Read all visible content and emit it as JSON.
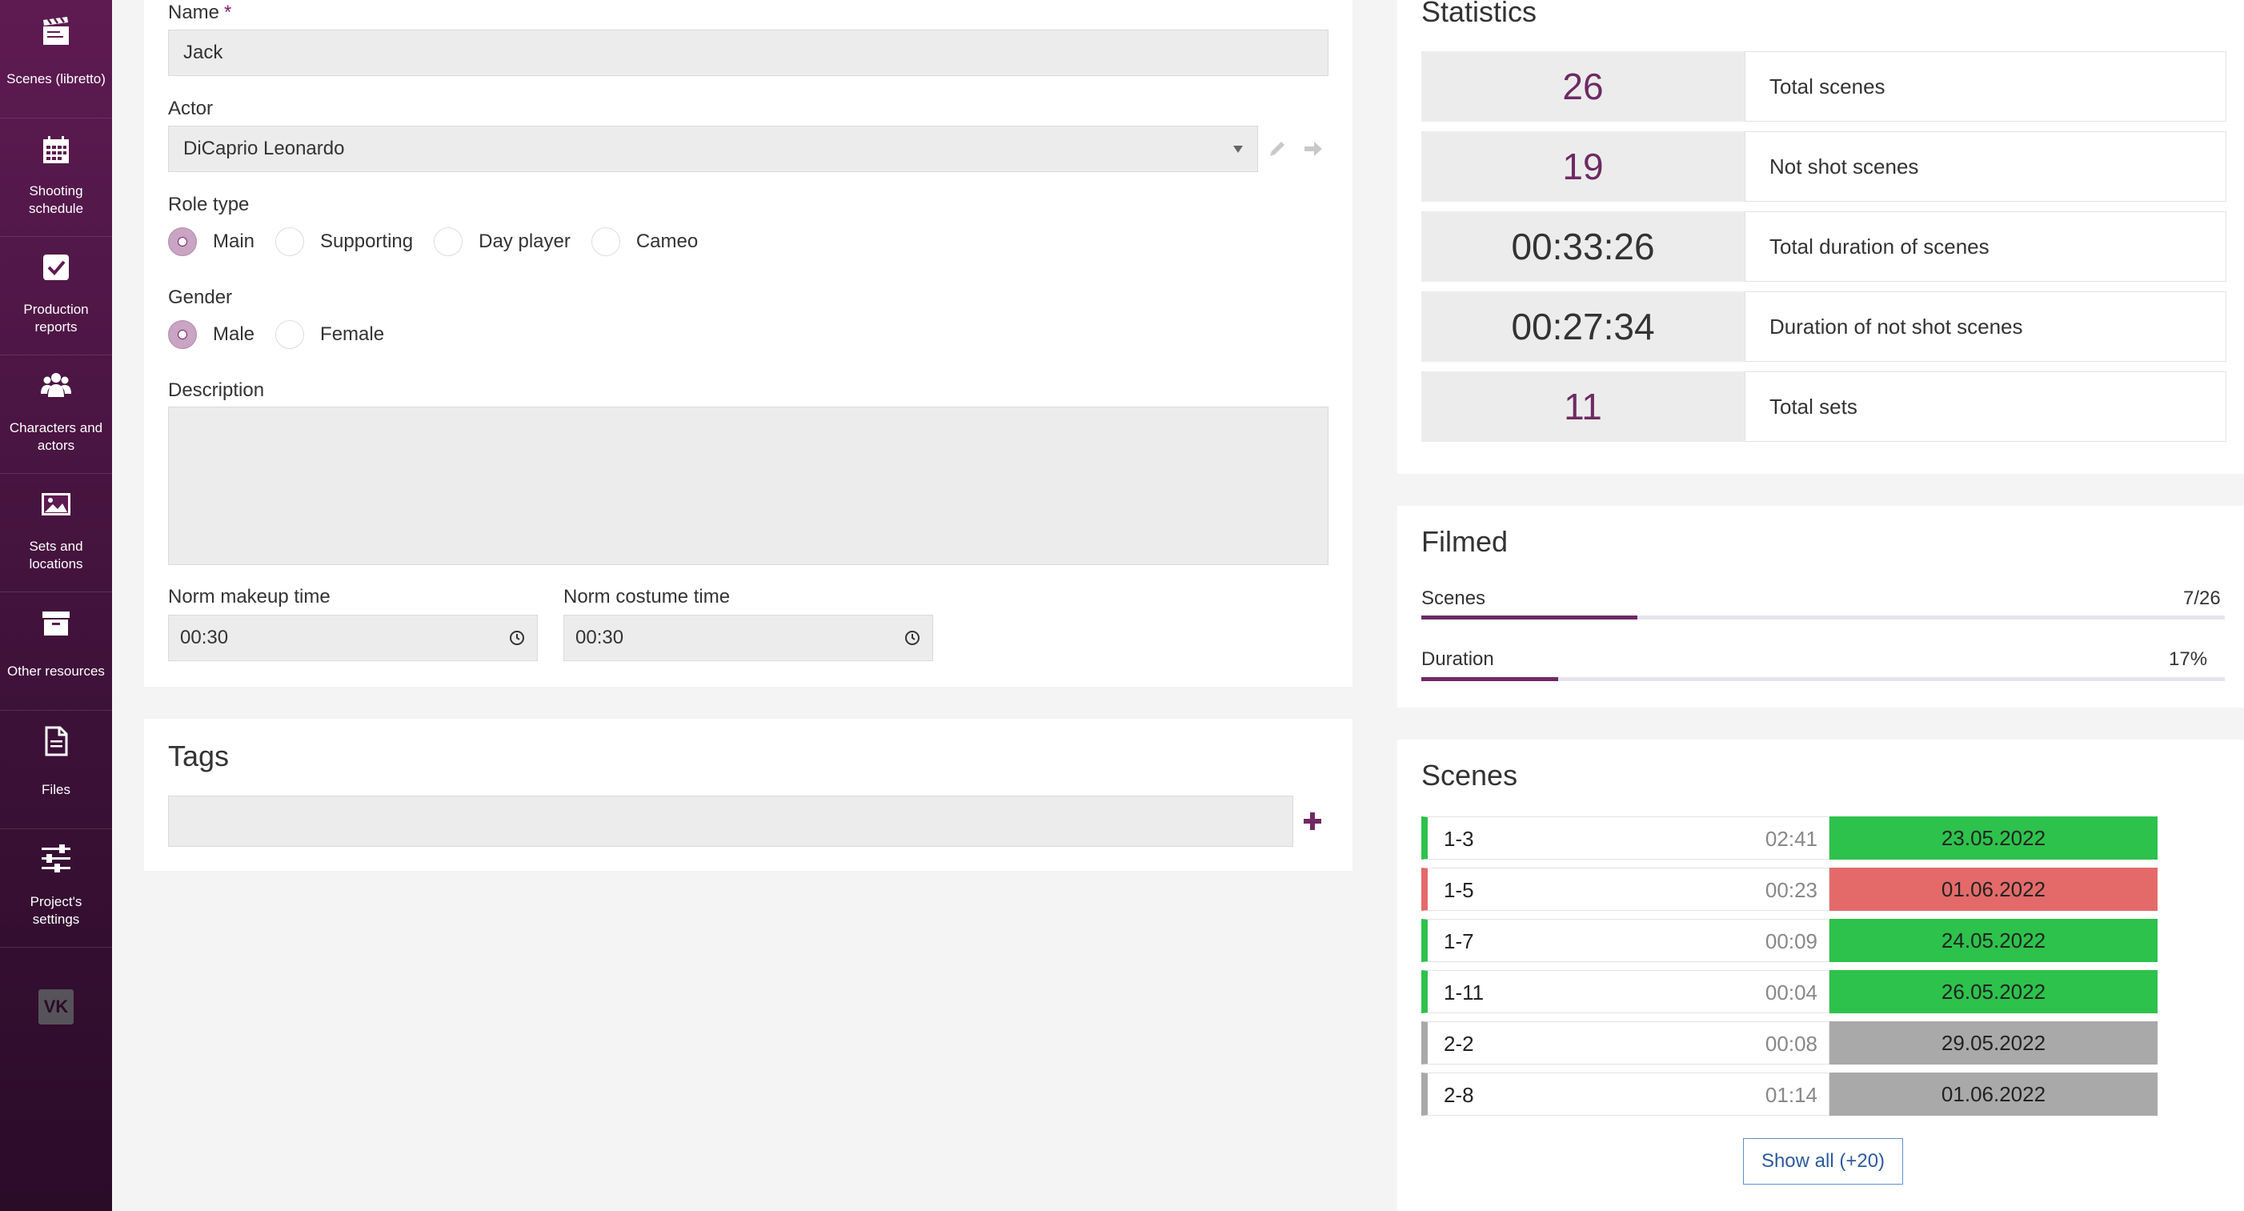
{
  "sidebar": {
    "items": [
      {
        "label": "Scenes (libretto)",
        "icon": "clapperboard-icon"
      },
      {
        "label": "Shooting\nschedule",
        "icon": "calendar-icon"
      },
      {
        "label": "Production\nreports",
        "icon": "checkbox-icon"
      },
      {
        "label": "Characters and\nactors",
        "icon": "people-icon"
      },
      {
        "label": "Sets and\nlocations",
        "icon": "image-icon"
      },
      {
        "label": "Other resources",
        "icon": "archive-icon"
      },
      {
        "label": "Files",
        "icon": "file-icon"
      },
      {
        "label": "Project's\nsettings",
        "icon": "sliders-icon"
      }
    ],
    "vk_icon": "vk-icon"
  },
  "form": {
    "name_label": "Name",
    "name_required": "*",
    "name_value": "Jack",
    "actor_label": "Actor",
    "actor_value": "DiCaprio Leonardo",
    "role_type_label": "Role type",
    "role_types": [
      "Main",
      "Supporting",
      "Day player",
      "Cameo"
    ],
    "role_type_selected": "Main",
    "gender_label": "Gender",
    "genders": [
      "Male",
      "Female"
    ],
    "gender_selected": "Male",
    "description_label": "Description",
    "description_value": "",
    "makeup_label": "Norm makeup time",
    "makeup_value": "00:30",
    "costume_label": "Norm costume time",
    "costume_value": "00:30"
  },
  "tags": {
    "title": "Tags",
    "add_icon": "plus-icon"
  },
  "statistics": {
    "title": "Statistics",
    "rows": [
      {
        "value": "26",
        "label": "Total scenes",
        "color": "#6e2a64"
      },
      {
        "value": "19",
        "label": "Not shot scenes",
        "color": "#6e2a64"
      },
      {
        "value": "00:33:26",
        "label": "Total duration of scenes",
        "color": "#333333"
      },
      {
        "value": "00:27:34",
        "label": "Duration of not shot scenes",
        "color": "#333333"
      },
      {
        "value": "11",
        "label": "Total sets",
        "color": "#6e2a64"
      }
    ]
  },
  "filmed": {
    "title": "Filmed",
    "scenes_label": "Scenes",
    "scenes_value": "7/26",
    "scenes_fraction": 0.269,
    "duration_label": "Duration",
    "duration_value": "17%",
    "duration_fraction": 0.17
  },
  "scenes": {
    "title": "Scenes",
    "rows": [
      {
        "id": "1-3",
        "duration": "02:41",
        "date": "23.05.2022",
        "status_color": "#2dc24c"
      },
      {
        "id": "1-5",
        "duration": "00:23",
        "date": "01.06.2022",
        "status_color": "#e46a6a"
      },
      {
        "id": "1-7",
        "duration": "00:09",
        "date": "24.05.2022",
        "status_color": "#2dc24c"
      },
      {
        "id": "1-11",
        "duration": "00:04",
        "date": "26.05.2022",
        "status_color": "#2dc24c"
      },
      {
        "id": "2-2",
        "duration": "00:08",
        "date": "29.05.2022",
        "status_color": "#a9a9a9"
      },
      {
        "id": "2-8",
        "duration": "01:14",
        "date": "01.06.2022",
        "status_color": "#a9a9a9"
      }
    ],
    "show_all_label": "Show all (+20)"
  },
  "colors": {
    "accent": "#6e2a64",
    "sidebar_top": "#5e1b52",
    "sidebar_bottom": "#2a0b28",
    "shot": "#2dc24c",
    "overdue": "#e46a6a",
    "planned": "#a9a9a9"
  }
}
